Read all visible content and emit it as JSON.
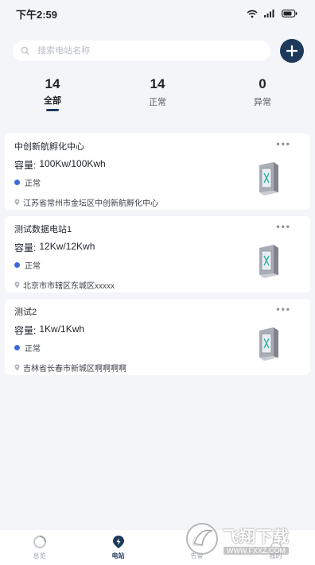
{
  "status_bar": {
    "time": "下午2:59"
  },
  "search": {
    "placeholder": "搜索电站名称"
  },
  "tabs": [
    {
      "count": "14",
      "label": "全部",
      "active": true
    },
    {
      "count": "14",
      "label": "正常",
      "active": false
    },
    {
      "count": "0",
      "label": "异常",
      "active": false
    }
  ],
  "stations": [
    {
      "name": "中创新航孵化中心",
      "capacity_label": "容量:",
      "capacity_value": "100Kw/100Kwh",
      "status": "正常",
      "address": "江苏省常州市金坛区中创新航孵化中心"
    },
    {
      "name": "测试数据电站1",
      "capacity_label": "容量:",
      "capacity_value": "12Kw/12Kwh",
      "status": "正常",
      "address": "北京市市辖区东城区xxxxx"
    },
    {
      "name": "测试2",
      "capacity_label": "容量:",
      "capacity_value": "1Kw/1Kwh",
      "status": "正常",
      "address": "吉林省长春市新城区啊啊啊啊"
    }
  ],
  "card_more": "•••",
  "nav": [
    {
      "label": "总览",
      "icon": "overview-icon",
      "active": false
    },
    {
      "label": "电站",
      "icon": "station-icon",
      "active": true
    },
    {
      "label": "告警",
      "icon": "alarm-icon",
      "active": false
    },
    {
      "label": "我的",
      "icon": "profile-icon",
      "active": false
    }
  ],
  "watermark": {
    "title": "飞翔下载",
    "url": "WWW.FXXZ.COM"
  },
  "colors": {
    "accent": "#1d3a5c",
    "status_dot": "#3c6ad9",
    "background": "#f4f5f8"
  }
}
